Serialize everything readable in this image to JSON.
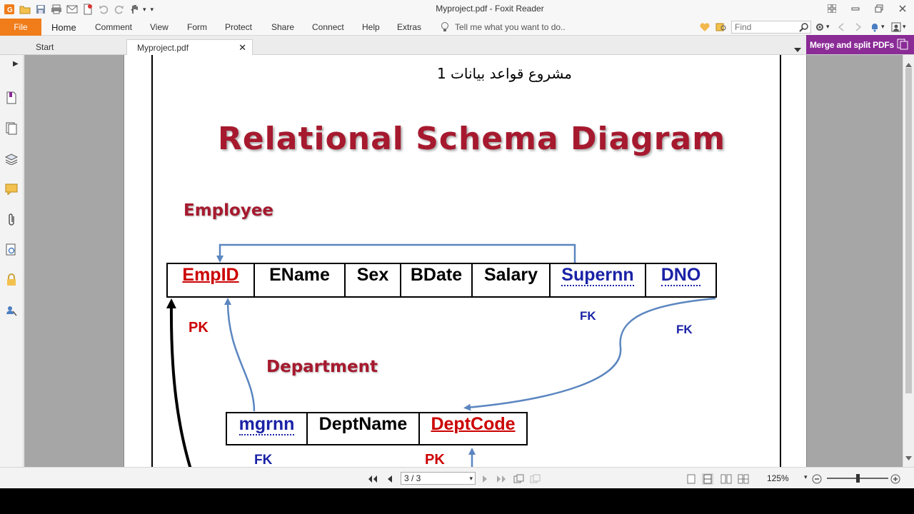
{
  "window": {
    "title": "Myproject.pdf - Foxit Reader"
  },
  "menu": {
    "file": "File",
    "tabs": [
      "Home",
      "Comment",
      "View",
      "Form",
      "Protect",
      "Share",
      "Connect",
      "Help",
      "Extras"
    ],
    "tell_me": "Tell me what you want to do..",
    "find_placeholder": "Find"
  },
  "doc_tabs": {
    "start": "Start",
    "document": "Myproject.pdf"
  },
  "promo": {
    "label": "Merge and split PDFs"
  },
  "document": {
    "arabic_title": "مشروع قواعد بيانات 1",
    "slide_title": "Relational Schema Diagram",
    "employee": {
      "label": "Employee",
      "columns": [
        "EmpID",
        "EName",
        "Sex",
        "BDate",
        "Salary",
        "Supernn",
        "DNO"
      ],
      "pk_label": "PK",
      "fk_labels": [
        "FK",
        "FK"
      ]
    },
    "department": {
      "label": "Department",
      "columns": [
        "mgrnn",
        "DeptName",
        "DeptCode"
      ],
      "fk_label": "FK",
      "pk_label": "PK"
    }
  },
  "status": {
    "page_indicator": "3 / 3",
    "zoom": "125%",
    "zoom_level": 0.5
  },
  "colors": {
    "file_tab": "#f07c1a",
    "promo": "#8a2b96",
    "primary_key": "#cc0000",
    "foreign_key": "#1a22a6",
    "title_red": "#a6192e"
  }
}
